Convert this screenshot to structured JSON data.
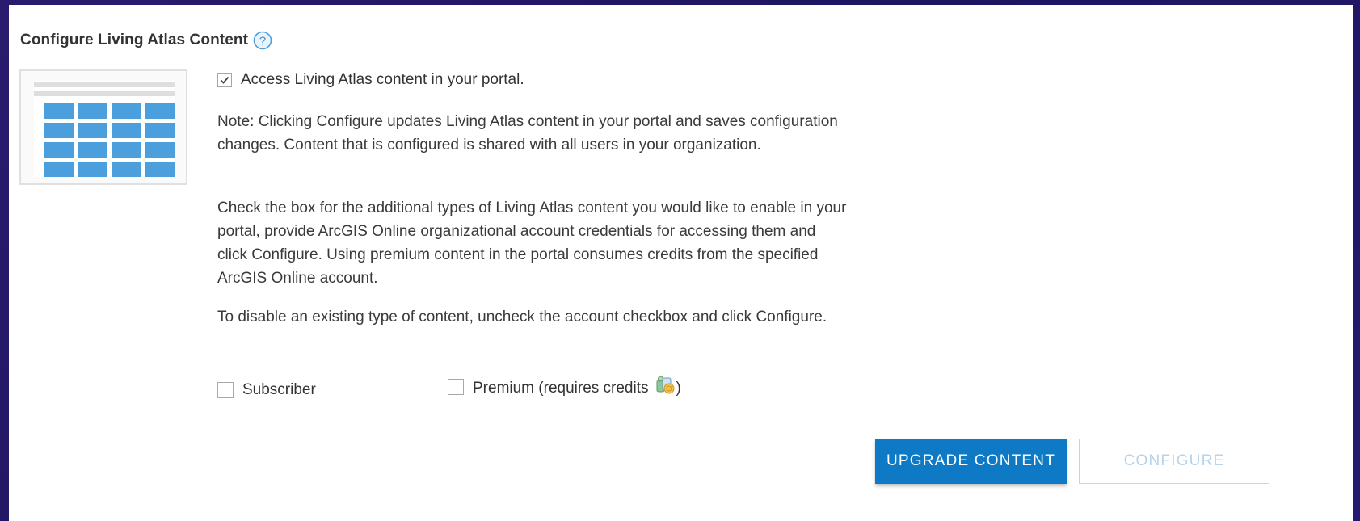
{
  "section": {
    "title": "Configure Living Atlas Content",
    "help_icon": "question-circle-icon"
  },
  "access_checkbox": {
    "label": "Access Living Atlas content in your portal.",
    "checked": true
  },
  "paragraphs": {
    "note": "Note: Clicking Configure updates Living Atlas content in your portal and saves configuration changes. Content that is configured is shared with all users in your organization.",
    "instructions": "Check the box for the additional types of Living Atlas content you would like to enable in your portal, provide ArcGIS Online organizational account credentials for accessing them and click Configure. Using premium content in the portal consumes credits from the specified ArcGIS Online account.",
    "disable": "To disable an existing type of content, uncheck the account checkbox and click Configure."
  },
  "content_types": {
    "subscriber_label": "Subscriber",
    "subscriber_checked": false,
    "premium_label": "Premium (requires credits",
    "premium_close": ")",
    "premium_checked": false,
    "premium_icon": "credits-icon"
  },
  "buttons": {
    "upgrade_label": "UPGRADE CONTENT",
    "configure_label": "CONFIGURE"
  },
  "colors": {
    "accent": "#0e79c5",
    "disabled_text": "#b5d3ea",
    "thumbnail_tiles": "#4a9fdc"
  }
}
